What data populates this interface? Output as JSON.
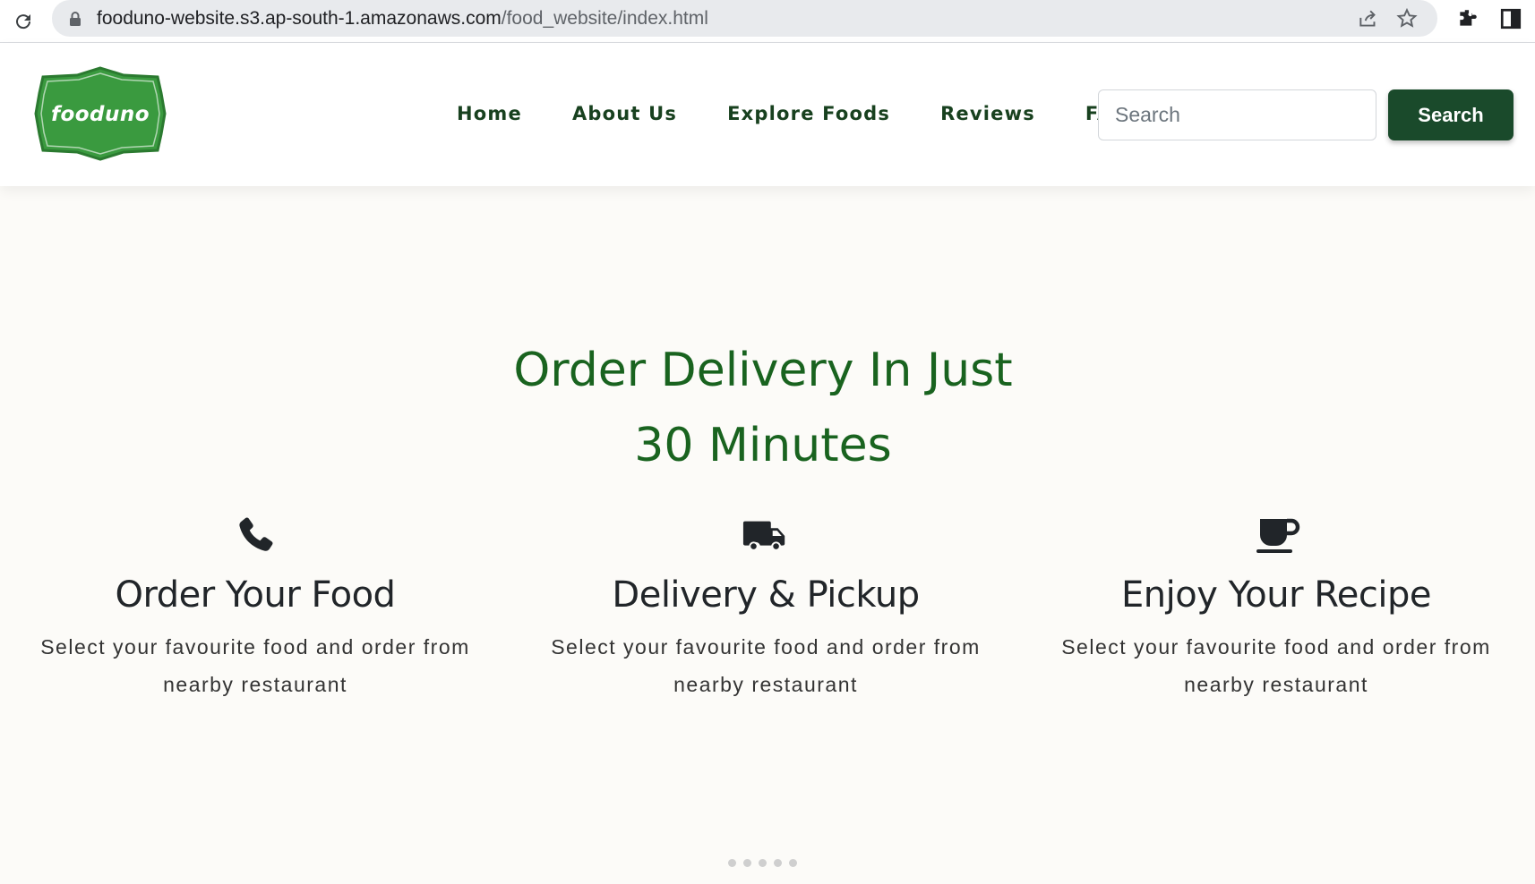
{
  "browser": {
    "url_host": "fooduno-website.s3.ap-south-1.amazonaws.com",
    "url_path": "/food_website/index.html",
    "icons": [
      "reload-icon",
      "lock-icon",
      "share-icon",
      "star-icon",
      "extensions-icon",
      "sidepanel-icon"
    ]
  },
  "header": {
    "logo_text": "fooduno",
    "nav": [
      "Home",
      "About Us",
      "Explore Foods",
      "Reviews",
      "FAQ"
    ],
    "search_placeholder": "Search",
    "search_button": "Search"
  },
  "hero": {
    "title_line1": "Order Delivery In Just",
    "title_line2": "30 Minutes"
  },
  "features": [
    {
      "icon": "phone-icon",
      "title": "Order Your Food",
      "text": "Select your favourite food and order from nearby restaurant"
    },
    {
      "icon": "truck-icon",
      "title": "Delivery & Pickup",
      "text": "Select your favourite food and order from nearby restaurant"
    },
    {
      "icon": "coffee-icon",
      "title": "Enjoy Your Recipe",
      "text": "Select your favourite food and order from nearby restaurant"
    }
  ],
  "carousel": {
    "dot_count": 5
  },
  "colors": {
    "brand_green": "#19631f",
    "nav_green": "#18411f",
    "button_green": "#1a4a2b",
    "logo_green": "#3a9a3f"
  }
}
